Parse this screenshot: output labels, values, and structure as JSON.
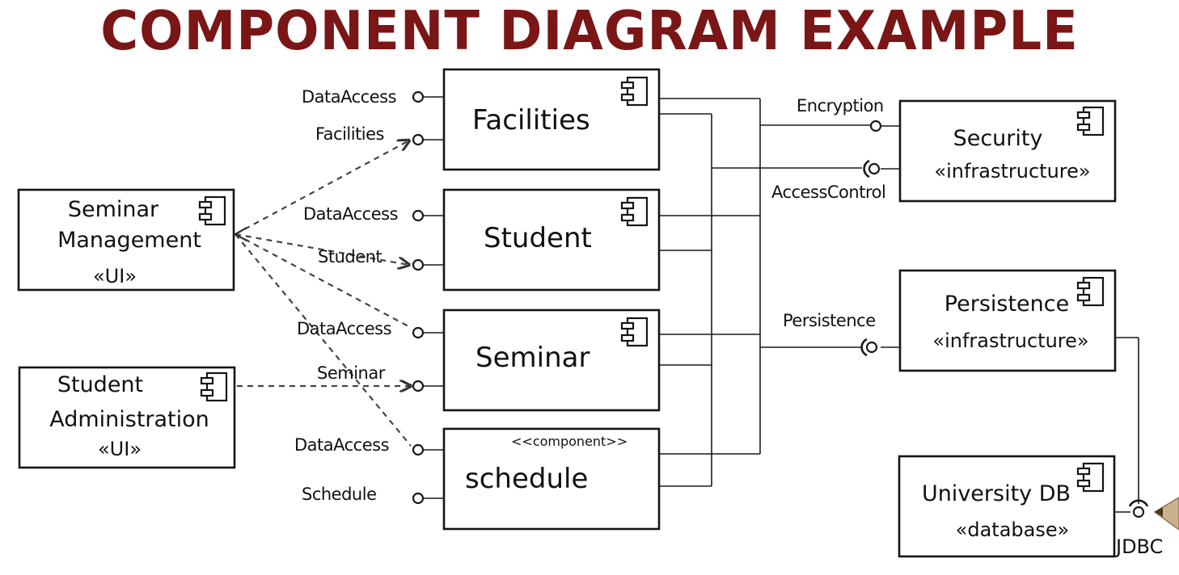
{
  "title": "COMPONENT DIAGRAM EXAMPLE",
  "components": {
    "facilities": {
      "name": "Facilities"
    },
    "student": {
      "name": "Student"
    },
    "seminar": {
      "name": "Seminar"
    },
    "schedule": {
      "name": "schedule",
      "stereotype": "<<component>>"
    },
    "seminar_management": {
      "line1": "Seminar",
      "line2": "Management",
      "stereotype": "«UI»"
    },
    "student_administration": {
      "line1": "Student",
      "line2": "Administration",
      "stereotype": "«UI»"
    },
    "security": {
      "name": "Security",
      "stereotype": "«infrastructure»"
    },
    "persistence": {
      "name": "Persistence",
      "stereotype": "«infrastructure»"
    },
    "university_db": {
      "name": "University DB",
      "stereotype": "«database»"
    }
  },
  "interfaces": {
    "facilities_dataaccess": "DataAccess",
    "facilities": "Facilities",
    "student_dataaccess": "DataAccess",
    "student": "Student",
    "seminar_dataaccess": "DataAccess",
    "seminar": "Seminar",
    "schedule_dataaccess": "DataAccess",
    "schedule": "Schedule",
    "encryption": "Encryption",
    "access_control": "AccessControl",
    "persistence": "Persistence",
    "jdbc": "JDBC"
  },
  "icons": [
    "component-icon"
  ],
  "colors": {
    "title": "#7a1616",
    "ink": "#151515"
  }
}
